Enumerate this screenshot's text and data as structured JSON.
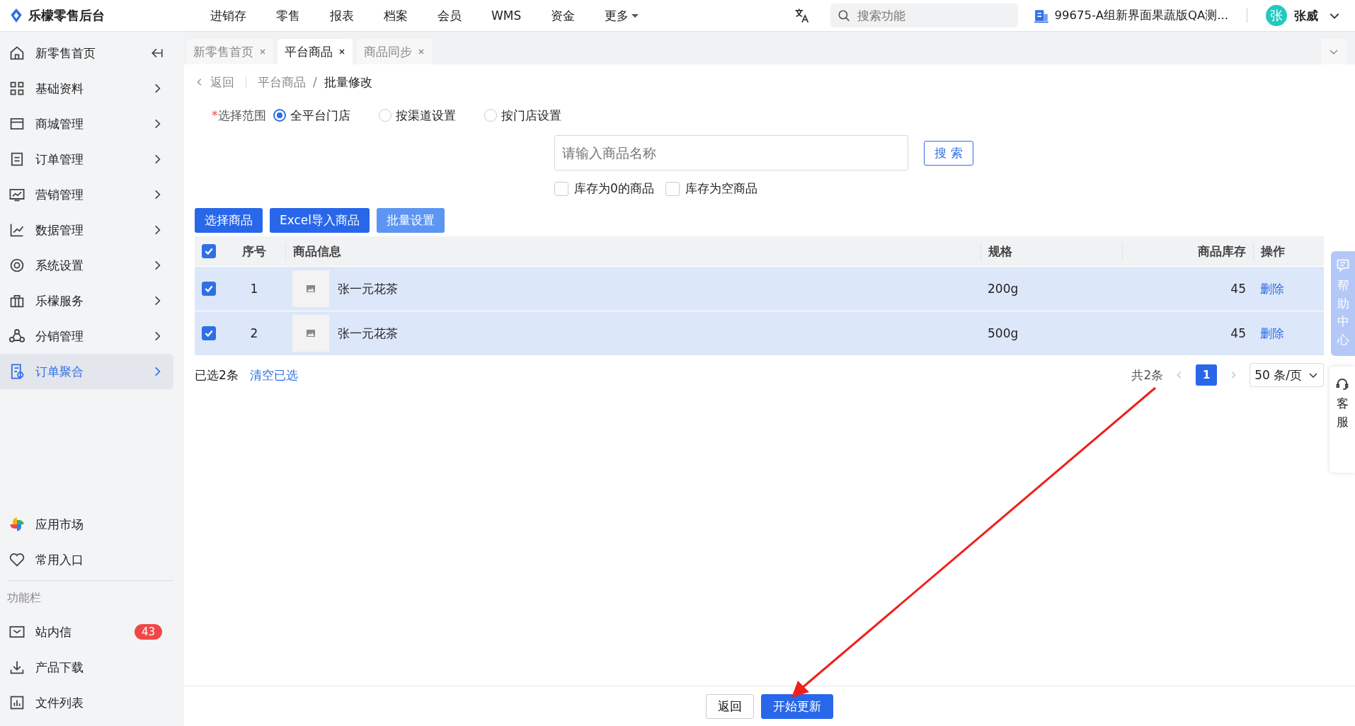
{
  "app": {
    "logo_text": "乐檬零售后台"
  },
  "top_nav": [
    "进销存",
    "零售",
    "报表",
    "档案",
    "会员",
    "WMS",
    "资金"
  ],
  "more_menu": "更多",
  "search": {
    "placeholder": "搜索功能"
  },
  "store": "99675-A组新界面果蔬版QA测...",
  "user": {
    "avatar": "张",
    "name": "张威"
  },
  "sidebar": {
    "items": [
      {
        "label": "新零售首页",
        "selected": false
      },
      {
        "label": "基础资料",
        "selected": false
      },
      {
        "label": "商城管理",
        "selected": false
      },
      {
        "label": "订单管理",
        "selected": false
      },
      {
        "label": "营销管理",
        "selected": false
      },
      {
        "label": "数据管理",
        "selected": false
      },
      {
        "label": "系统设置",
        "selected": false
      },
      {
        "label": "乐檬服务",
        "selected": false
      },
      {
        "label": "分销管理",
        "selected": false
      },
      {
        "label": "订单聚合",
        "selected": true
      }
    ],
    "bottom_items": [
      "应用市场",
      "常用入口"
    ],
    "section_title": "功能栏",
    "tools": [
      {
        "label": "站内信",
        "badge": "43"
      },
      {
        "label": "产品下载"
      },
      {
        "label": "文件列表"
      }
    ]
  },
  "tabs": [
    {
      "label": "新零售首页",
      "selected": false
    },
    {
      "label": "平台商品",
      "selected": true
    },
    {
      "label": "商品同步",
      "selected": false
    }
  ],
  "breadcrumb": {
    "back": "返回",
    "separator": "/",
    "path": [
      "平台商品",
      "批量修改"
    ]
  },
  "scope": {
    "label": "选择范围",
    "required_mark": "*",
    "options": [
      {
        "label": "全平台门店",
        "selected": true
      },
      {
        "label": "按渠道设置",
        "selected": false
      },
      {
        "label": "按门店设置",
        "selected": false
      }
    ]
  },
  "product_search": {
    "placeholder": "请输入商品名称",
    "button": "搜 索"
  },
  "filters": [
    {
      "label": "库存为0的商品",
      "checked": false
    },
    {
      "label": "库存为空商品",
      "checked": false
    }
  ],
  "actions": [
    {
      "label": "选择商品",
      "disabled": false
    },
    {
      "label": "Excel导入商品",
      "disabled": false
    },
    {
      "label": "批量设置",
      "disabled": true
    }
  ],
  "table": {
    "select_all": true,
    "columns": [
      "序号",
      "商品信息",
      "规格",
      "商品库存",
      "操作"
    ],
    "rows": [
      {
        "selected": true,
        "index": "1",
        "name": "张一元花茶",
        "spec": "200g",
        "stock": "45",
        "action": "删除"
      },
      {
        "selected": true,
        "index": "2",
        "name": "张一元花茶",
        "spec": "500g",
        "stock": "45",
        "action": "删除"
      }
    ]
  },
  "selection": {
    "summary": "已选2条",
    "clear": "清空已选"
  },
  "pagination": {
    "total": "共2条",
    "pages": [
      {
        "label": "1",
        "selected": true
      }
    ],
    "page_size": "50 条/页"
  },
  "footer": {
    "buttons": [
      {
        "label": "返回",
        "kind": "default"
      },
      {
        "label": "开始更新",
        "kind": "primary"
      }
    ]
  },
  "side_widgets": {
    "help": "帮助中心",
    "service": "客服"
  }
}
